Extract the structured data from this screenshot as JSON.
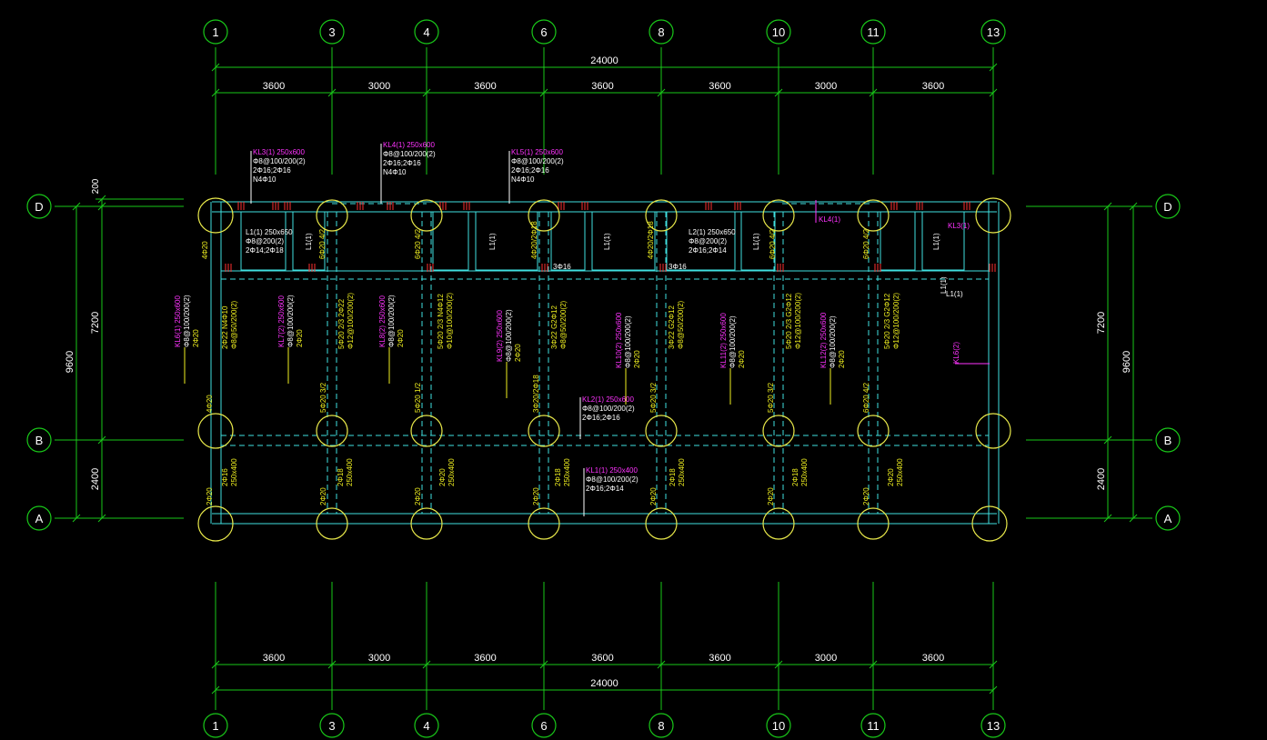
{
  "axes": {
    "columns": [
      "1",
      "3",
      "4",
      "6",
      "8",
      "10",
      "11",
      "13"
    ],
    "rows": [
      "D",
      "B",
      "A"
    ]
  },
  "dimensions": {
    "total_width": "24000",
    "spans": [
      "3600",
      "3000",
      "3600",
      "3600",
      "3600",
      "3000",
      "3600"
    ],
    "left_total": "9600",
    "left_parts": [
      "200",
      "7200",
      "2400"
    ],
    "right_total": "9600",
    "right_parts": [
      "7200",
      "2400"
    ]
  },
  "beam_labels": {
    "top": [
      {
        "lines": [
          "KL3(1) 250x600",
          "Φ8@100/200(2)",
          "2Φ16;2Φ16",
          "N4Φ10"
        ]
      },
      {
        "lines": [
          "KL4(1) 250x600",
          "Φ8@100/200(2)",
          "2Φ16;2Φ16",
          "N4Φ10"
        ]
      },
      {
        "lines": [
          "KL5(1) 250x600",
          "Φ8@100/200(2)",
          "2Φ16;2Φ16",
          "N4Φ10"
        ]
      }
    ],
    "l1": {
      "lines": [
        "L1(1) 250x650",
        "Φ8@200(2)",
        "2Φ14;2Φ18"
      ]
    },
    "l2": {
      "lines": [
        "L2(1) 250x650",
        "Φ8@200(2)",
        "2Φ16;2Φ14"
      ]
    },
    "kl2": {
      "lines": [
        "KL2(1) 250x600",
        "Φ8@100/200(2)",
        "2Φ16;2Φ16"
      ]
    },
    "kl1": {
      "lines": [
        "KL1(1) 250x400",
        "Φ8@100/200(2)",
        "2Φ16;2Φ14"
      ]
    },
    "small": [
      "L1(1)",
      "L1(1)",
      "L1(1)",
      "L1(1)",
      "L1(1)",
      "L1(1)",
      "KL4(1)",
      "KL3(1)",
      "L1(1)",
      "KL6(2)"
    ],
    "vertical_magenta": [
      "KL6(1) 250x600",
      "KL7(2) 250x600",
      "KL8(2) 250x600",
      "KL9(2) 250x600",
      "KL10(2) 250x600",
      "KL11(2) 250x600",
      "KL12(2) 250x600"
    ],
    "vertical_white": [
      "Φ8@100/200(2)",
      "Φ8@100/200(2)",
      "Φ8@100/200(2)",
      "Φ8@100/200(2)",
      "Φ8@100/200(2)",
      "Φ8@100/200(2)",
      "Φ8@100/200(2)"
    ],
    "vertical_yellow": [
      "2Φ20",
      "2Φ20",
      "2Φ20",
      "2Φ20",
      "2Φ20",
      "2Φ20",
      "2Φ20"
    ],
    "web_labels": [
      "2Φ22 N4Φ10",
      "5Φ20 2/3 2Φ22",
      "5Φ20 2/3 N4Φ12",
      "3Φ22 G2Φ12",
      "3Φ22 G2Φ12",
      "5Φ20 2/3 G2Φ12",
      "5Φ20 2/3 G2Φ12"
    ],
    "web_stirrups": [
      "Φ8@50/200(2)",
      "Φ12@100/200(2)",
      "Φ10@100/200(2)",
      "Φ8@50/200(2)",
      "Φ8@50/200(2)",
      "Φ12@100/200(2)",
      "Φ12@100/200(2)"
    ],
    "bay_labels": [
      "2Φ16 250x400",
      "2Φ18 250x400",
      "2Φ20 250x400",
      "2Φ18 250x400",
      "2Φ18 250x400",
      "2Φ18 250x400",
      "2Φ20 250x400"
    ],
    "bottom_bars": [
      "2Φ20",
      "2Φ20",
      "2Φ20",
      "2Φ20",
      "2Φ20",
      "2Φ20",
      "2Φ20"
    ],
    "mid_bars": [
      "4Φ20",
      "5Φ20 3/2",
      "5Φ20 1/2",
      "3Φ20/2Φ18",
      "5Φ20 3/2",
      "5Φ20 3/2",
      "6Φ20 4/2"
    ],
    "top_bars": [
      "4Φ20",
      "6Φ20 4/2",
      "6Φ20 4/2",
      "4Φ20/2Φ18",
      "4Φ20/2Φ18",
      "6Φ20 4/2",
      "6Φ20 4/2"
    ],
    "misc": [
      "3Φ16",
      "3Φ16"
    ]
  },
  "colors": {
    "grid": "#19c819",
    "column": "#e8e84a",
    "beam": "#40e0e0",
    "label_magenta": "#ff33ff",
    "label_white": "#ffffff",
    "label_yellow": "#f0f020",
    "tick": "#ff3030"
  }
}
